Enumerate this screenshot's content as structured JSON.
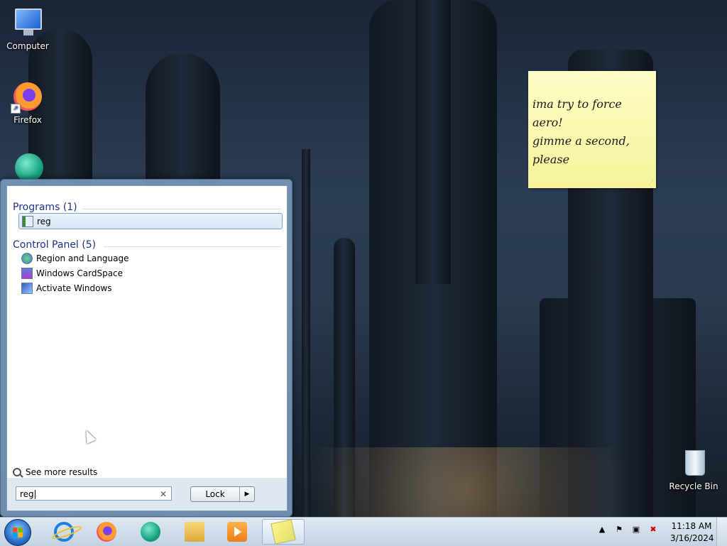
{
  "desktop": {
    "icons": [
      {
        "label": "Computer"
      },
      {
        "label": "Firefox"
      },
      {
        "label": "Recycle Bin"
      }
    ]
  },
  "sticky_note": {
    "lines": [
      "ima try to force aero!",
      "gimme a second,",
      "please"
    ]
  },
  "start_menu": {
    "groups": [
      {
        "title": "Programs (1)",
        "items": [
          {
            "label": "reg",
            "icon": "registry-icon",
            "selected": true
          }
        ]
      },
      {
        "title": "Control Panel (5)",
        "items": [
          {
            "label": "Region and Language",
            "icon": "globe-icon"
          },
          {
            "label": "Windows CardSpace",
            "icon": "cardspace-icon"
          },
          {
            "label": "Activate Windows",
            "icon": "activate-windows-icon"
          }
        ]
      }
    ],
    "see_more": "See more results",
    "search": {
      "value": "reg"
    },
    "power_button": {
      "label": "Lock"
    }
  },
  "taskbar": {
    "pinned": [
      "internet-explorer-icon",
      "firefox-icon",
      "edge-icon",
      "file-explorer-icon",
      "media-player-icon",
      "sticky-notes-icon"
    ],
    "clock": {
      "time": "11:18 AM",
      "date": "3/16/2024"
    },
    "tray_icons": [
      "show-hidden-icons-icon",
      "action-center-flag-icon",
      "network-icon",
      "volume-muted-icon"
    ]
  }
}
